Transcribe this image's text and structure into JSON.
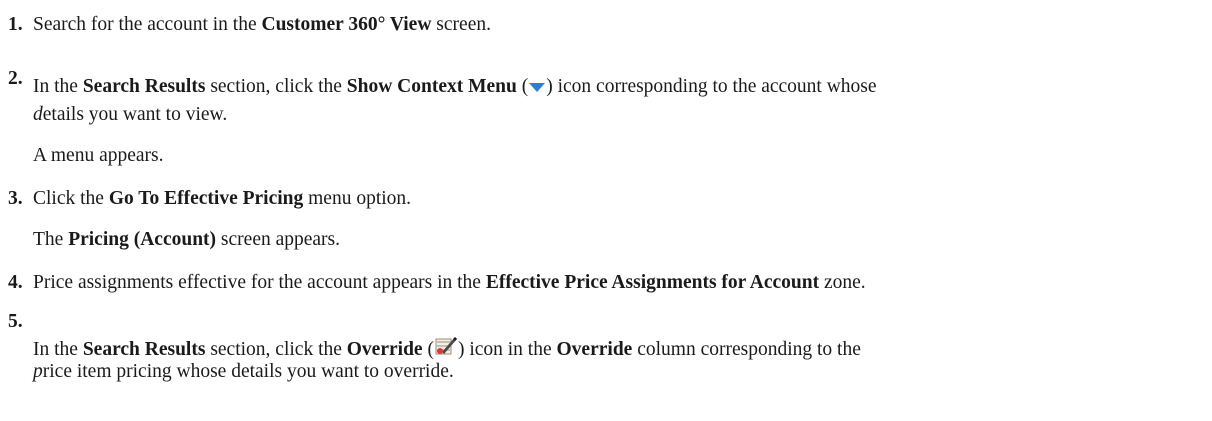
{
  "steps": [
    {
      "number": "1.",
      "a": "Search for the account in the ",
      "b1": "Customer 360° View",
      "c": " screen."
    },
    {
      "number": "2.",
      "a": "In the ",
      "b1": "Search Results",
      "c": " section, click the ",
      "b2": "Show Context Menu",
      "d": " (",
      "e": ") icon corresponding to the account whose",
      "line2_italic": "d",
      "line2_rest": "etails you want to view.",
      "result": "A menu appears."
    },
    {
      "number": "3.",
      "a": "Click the ",
      "b1": "Go To Effective Pricing",
      "c": " menu option.",
      "result_b": "Pricing (Account)",
      "result_rest": " screen appears.",
      "result_the": "The "
    },
    {
      "number": "4.",
      "a": "Price assignments effective for the account appears in the ",
      "b1": "Effective Price Assignments for Account",
      "c": " zone."
    },
    {
      "number": "5.",
      "a": "In the ",
      "b1": "Search Results",
      "c": " section, click the ",
      "b2": "Override",
      "d": " (",
      "e": ") icon in the ",
      "b3": "Override",
      "f": " column corresponding to the",
      "line2_italic": "p",
      "line2_rest": "rice item pricing whose details you want to override."
    }
  ],
  "icons": {
    "context_menu": "chevron-down-icon",
    "override": "override-edit-icon",
    "context_menu_color": "#2a7fd4"
  }
}
